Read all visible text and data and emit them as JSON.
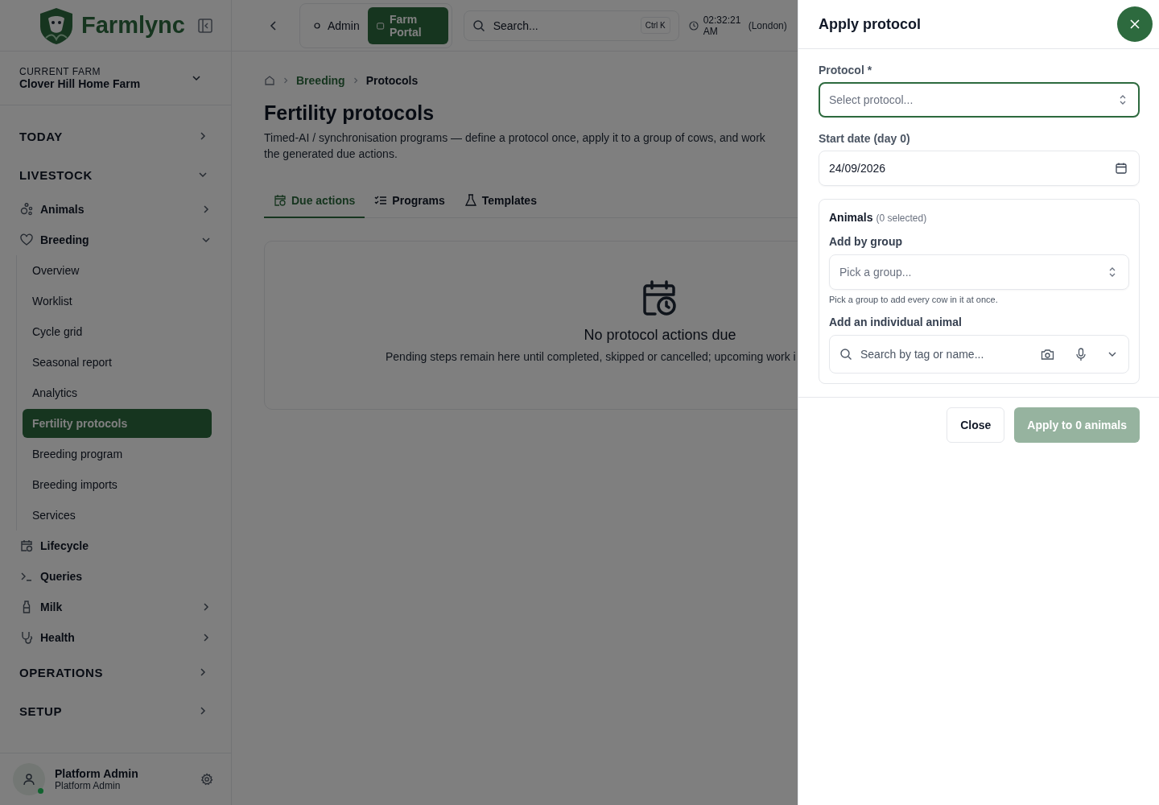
{
  "brand": {
    "name": "Farmlync"
  },
  "farm": {
    "caption": "CURRENT FARM",
    "name": "Clover Hill Home Farm"
  },
  "sidebar": {
    "sections": [
      {
        "label": "TODAY",
        "expanded": false
      },
      {
        "label": "LIVESTOCK",
        "expanded": true,
        "items": [
          {
            "label": "Animals",
            "kind": "group",
            "expanded": false
          },
          {
            "label": "Breeding",
            "kind": "group",
            "expanded": true,
            "children": [
              {
                "label": "Overview",
                "selected": false
              },
              {
                "label": "Worklist",
                "selected": false
              },
              {
                "label": "Cycle grid",
                "selected": false
              },
              {
                "label": "Seasonal report",
                "selected": false
              },
              {
                "label": "Analytics",
                "selected": false
              },
              {
                "label": "Fertility protocols",
                "selected": true
              },
              {
                "label": "Breeding program",
                "selected": false
              },
              {
                "label": "Breeding imports",
                "selected": false
              },
              {
                "label": "Services",
                "selected": false
              }
            ]
          },
          {
            "label": "Lifecycle",
            "kind": "link"
          },
          {
            "label": "Queries",
            "kind": "link"
          },
          {
            "label": "Milk",
            "kind": "group",
            "expanded": false
          },
          {
            "label": "Health",
            "kind": "group",
            "expanded": false
          }
        ]
      },
      {
        "label": "OPERATIONS",
        "expanded": false
      },
      {
        "label": "SETUP",
        "expanded": false
      }
    ]
  },
  "user": {
    "name": "Platform Admin",
    "role": "Platform Admin",
    "online": true
  },
  "topbar": {
    "switch": [
      {
        "label": "Admin",
        "selected": false
      },
      {
        "label": "Farm Portal",
        "selected": true
      }
    ],
    "search": {
      "placeholder": "Search...",
      "shortcut": "Ctrl K"
    },
    "time": "02:32:21 AM",
    "zone": "(London)"
  },
  "breadcrumb": [
    "Breeding",
    "Protocols"
  ],
  "page": {
    "title": "Fertility protocols",
    "description": "Timed-AI / synchronisation programs — define a protocol once, apply it to a group of cows, and work the generated due actions."
  },
  "tabs": [
    {
      "label": "Due actions",
      "selected": true
    },
    {
      "label": "Programs",
      "selected": false
    },
    {
      "label": "Templates",
      "selected": false
    }
  ],
  "empty_state": {
    "title": "No protocol actions due",
    "text": "Pending steps remain here until completed, skipped or cancelled; upcoming work i"
  },
  "drawer": {
    "title": "Apply protocol",
    "protocol": {
      "label": "Protocol *",
      "placeholder": "Select protocol...",
      "focused": true
    },
    "start_date": {
      "label": "Start date (day 0)",
      "value": "24/09/2026"
    },
    "animals": {
      "title": "Animals",
      "count": "(0 selected)",
      "group_label": "Add by group",
      "group_placeholder": "Pick a group...",
      "group_hint": "Pick a group to add every cow in it at once.",
      "individual_label": "Add an individual animal",
      "search_placeholder": "Search by tag or name..."
    },
    "buttons": [
      {
        "label": "Close",
        "kind": "secondary",
        "disabled": false
      },
      {
        "label": "Apply to 0 animals",
        "kind": "primary",
        "disabled": true
      }
    ]
  }
}
